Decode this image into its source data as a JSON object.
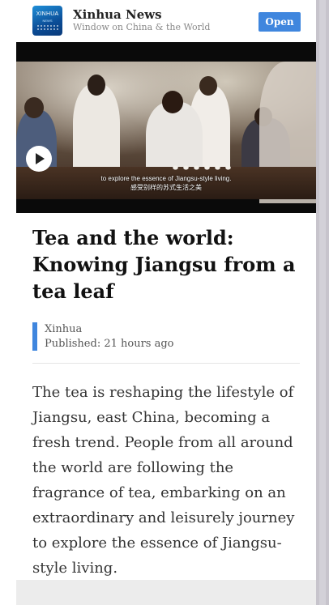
{
  "app_banner": {
    "logo_text": "XINHUA",
    "logo_subtext": "NEWS",
    "name": "Xinhua News",
    "tagline": "Window on China & the World",
    "open_label": "Open",
    "accent_color": "#3f86de",
    "logo_icon": "xinhua-logo-icon"
  },
  "video": {
    "subtitle_en": "to explore the essence of Jiangsu-style living.",
    "subtitle_zh": "感受别样的苏式生活之美",
    "play_icon": "play-icon"
  },
  "article": {
    "headline": "Tea and the world: Knowing Jiangsu from a tea leaf",
    "source": "Xinhua",
    "published_label": "Published:",
    "published_time": "21 hours ago",
    "body": "The tea is reshaping the lifestyle of Jiangsu, east China, becoming a fresh trend. People from all around the world are following the fragrance of tea, embarking on an extraordinary and leisurely journey to explore the essence of Jiangsu-style living."
  }
}
